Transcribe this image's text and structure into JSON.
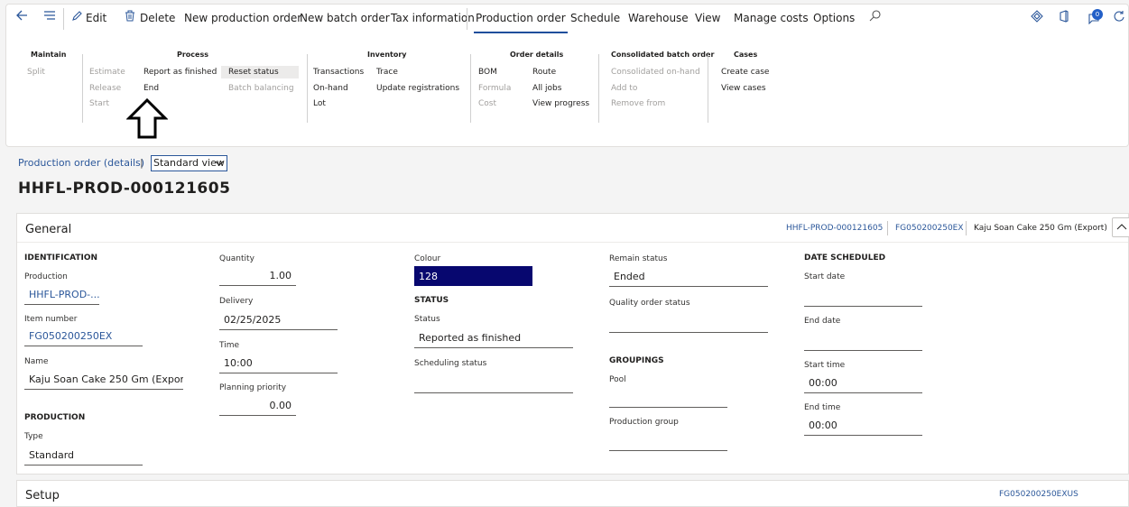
{
  "commandbar": {
    "edit": "Edit",
    "delete": "Delete",
    "new_production_order": "New production order",
    "new_batch_order": "New batch order",
    "tax_information": "Tax information",
    "tabs": [
      "Production order",
      "Schedule",
      "Warehouse",
      "View",
      "Manage costs",
      "Options"
    ],
    "badge_count": "0"
  },
  "ribbon": {
    "maintain": {
      "title": "Maintain",
      "split": "Split"
    },
    "process": {
      "title": "Process",
      "estimate": "Estimate",
      "release": "Release",
      "start": "Start",
      "report_as_finished": "Report as finished",
      "end": "End",
      "reset_status": "Reset status",
      "batch_balancing": "Batch balancing"
    },
    "inventory": {
      "title": "Inventory",
      "transactions": "Transactions",
      "on_hand": "On-hand",
      "lot": "Lot",
      "trace": "Trace",
      "update_registrations": "Update registrations"
    },
    "order_details": {
      "title": "Order details",
      "bom": "BOM",
      "formula": "Formula",
      "cost": "Cost",
      "route": "Route",
      "all_jobs": "All jobs",
      "view_progress": "View progress"
    },
    "consolidated": {
      "title": "Consolidated batch order",
      "consolidated_on_hand": "Consolidated on-hand",
      "add_to": "Add to",
      "remove_from": "Remove from"
    },
    "cases": {
      "title": "Cases",
      "create_case": "Create case",
      "view_cases": "View cases"
    }
  },
  "breadcrumb": {
    "link": "Production order (details)",
    "separator": "|",
    "view": "Standard view"
  },
  "page_title": "HHFL-PROD-000121605",
  "general": {
    "title": "General",
    "summary": {
      "production": "HHFL-PROD-000121605",
      "item": "FG050200250EX",
      "name": "Kaju Soan Cake 250 Gm (Export)"
    },
    "identification": {
      "heading": "IDENTIFICATION",
      "production_label": "Production",
      "production_value": "HHFL-PROD-...",
      "item_label": "Item number",
      "item_value": "FG050200250EX",
      "name_label": "Name",
      "name_value": "Kaju Soan Cake 250 Gm (Export)"
    },
    "production": {
      "heading": "PRODUCTION",
      "type_label": "Type",
      "type_value": "Standard"
    },
    "quantity": {
      "label": "Quantity",
      "value": "1.00"
    },
    "delivery": {
      "label": "Delivery",
      "value": "02/25/2025"
    },
    "time": {
      "label": "Time",
      "value": "10:00"
    },
    "planning_priority": {
      "label": "Planning priority",
      "value": "0.00"
    },
    "colour": {
      "label": "Colour",
      "value": "128",
      "color": "#07076f"
    },
    "status": {
      "heading": "STATUS",
      "status_label": "Status",
      "status_value": "Reported as finished",
      "scheduling_label": "Scheduling status",
      "scheduling_value": ""
    },
    "remain_status": {
      "label": "Remain status",
      "value": "Ended"
    },
    "quality_order_status": {
      "label": "Quality order status",
      "value": ""
    },
    "groupings": {
      "heading": "GROUPINGS",
      "pool_label": "Pool",
      "pool_value": "",
      "group_label": "Production group",
      "group_value": ""
    },
    "date_scheduled": {
      "heading": "DATE SCHEDULED",
      "start_date_label": "Start date",
      "start_date_value": "",
      "end_date_label": "End date",
      "end_date_value": "",
      "start_time_label": "Start time",
      "start_time_value": "00:00",
      "end_time_label": "End time",
      "end_time_value": "00:00"
    }
  },
  "setup": {
    "title": "Setup",
    "summary": "FG050200250EXUS"
  },
  "colors": {
    "accent": "#1f4e9c",
    "link": "#2b579a",
    "colour_swatch": "#07076f"
  },
  "icons": [
    "back-icon",
    "hamburger-menu-icon",
    "edit-icon",
    "delete-icon",
    "search-icon",
    "diamond-icon",
    "office-icon",
    "notifications-icon",
    "refresh-icon",
    "chevron-down-icon",
    "chevron-up-icon",
    "up-arrow-annotation"
  ]
}
